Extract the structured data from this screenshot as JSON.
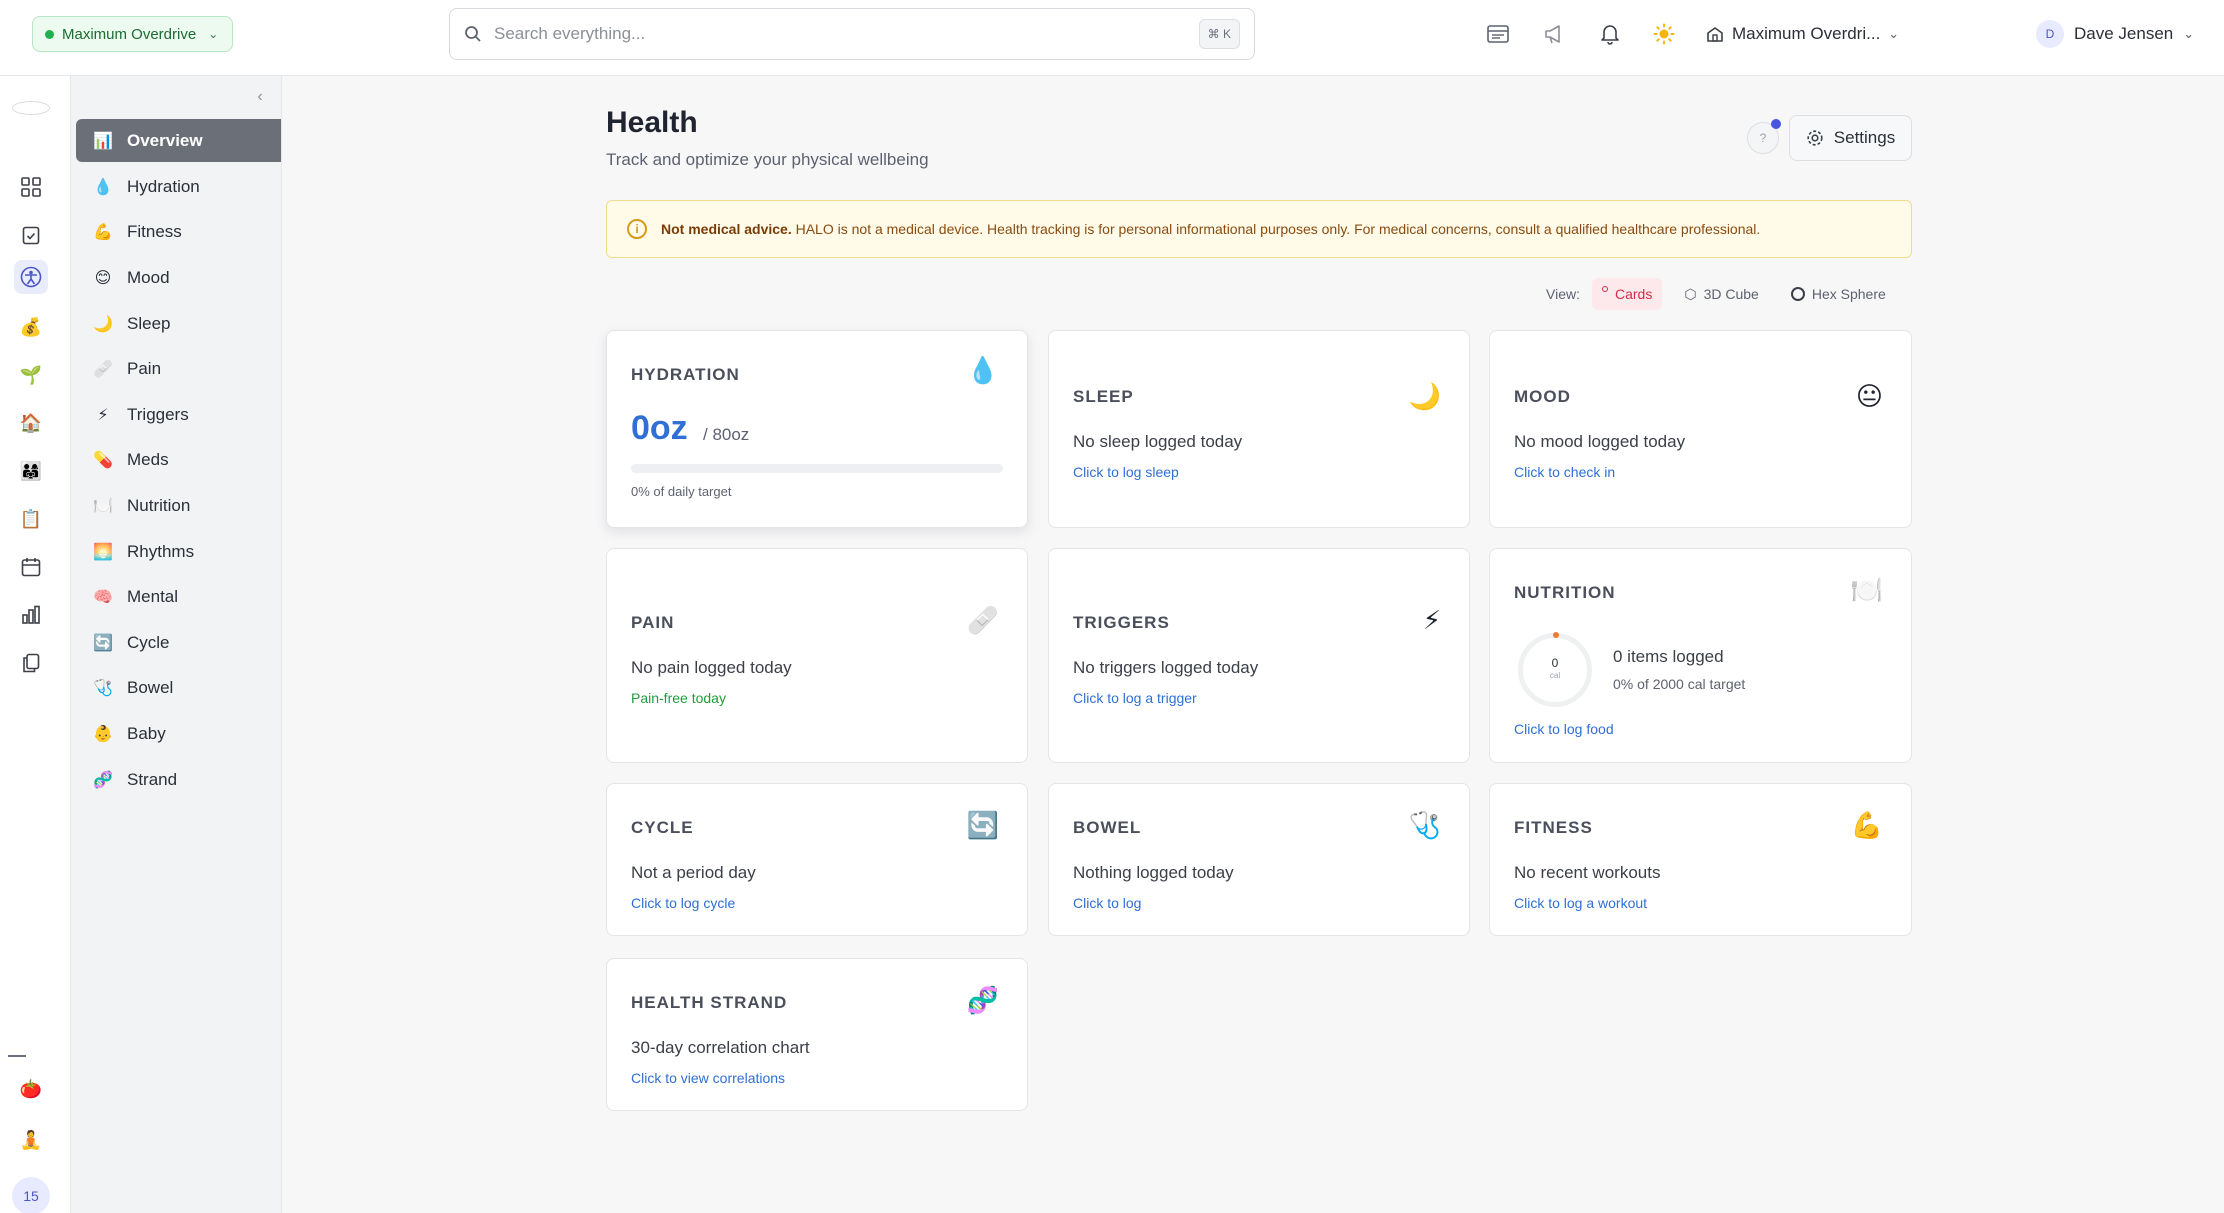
{
  "workspace": {
    "label": "Maximum Overdrive"
  },
  "search": {
    "placeholder": "Search everything...",
    "shortcut": "⌘ K"
  },
  "org": {
    "label": "Maximum Overdri..."
  },
  "user": {
    "initial": "D",
    "name": "Dave Jensen"
  },
  "rail": {
    "badge": "15"
  },
  "nav": [
    {
      "label": "Overview",
      "icon": "📊"
    },
    {
      "label": "Hydration",
      "icon": "💧"
    },
    {
      "label": "Fitness",
      "icon": "💪"
    },
    {
      "label": "Mood",
      "icon": "😊"
    },
    {
      "label": "Sleep",
      "icon": "🌙"
    },
    {
      "label": "Pain",
      "icon": "🩹"
    },
    {
      "label": "Triggers",
      "icon": "⚡"
    },
    {
      "label": "Meds",
      "icon": "💊"
    },
    {
      "label": "Nutrition",
      "icon": "🍽️"
    },
    {
      "label": "Rhythms",
      "icon": "🌅"
    },
    {
      "label": "Mental",
      "icon": "🧠"
    },
    {
      "label": "Cycle",
      "icon": "🔄"
    },
    {
      "label": "Bowel",
      "icon": "🩺"
    },
    {
      "label": "Baby",
      "icon": "👶"
    },
    {
      "label": "Strand",
      "icon": "🧬"
    }
  ],
  "page": {
    "title": "Health",
    "subtitle": "Track and optimize your physical wellbeing",
    "settings_label": "Settings"
  },
  "alert": {
    "strong": "Not medical advice.",
    "text": " HALO is not a medical device. Health tracking is for personal informational purposes only. For medical concerns, consult a qualified healthcare professional."
  },
  "view": {
    "label": "View:",
    "options": [
      "Cards",
      "3D Cube",
      "Hex Sphere"
    ],
    "selected": "Cards"
  },
  "cards": {
    "hydration": {
      "title": "HYDRATION",
      "icon": "💧",
      "value": "0oz",
      "target": "/ 80oz",
      "progress_pct": 0,
      "note": "0% of daily target"
    },
    "sleep": {
      "title": "SLEEP",
      "icon": "🌙",
      "text": "No sleep logged today",
      "link": "Click to log sleep"
    },
    "mood": {
      "title": "MOOD",
      "icon": "😐",
      "text": "No mood logged today",
      "link": "Click to check in"
    },
    "pain": {
      "title": "PAIN",
      "icon": "🩹",
      "text": "No pain logged today",
      "link": "Pain-free today"
    },
    "triggers": {
      "title": "TRIGGERS",
      "icon": "⚡",
      "text": "No triggers logged today",
      "link": "Click to log a trigger"
    },
    "nutrition": {
      "title": "NUTRITION",
      "icon": "🍽️",
      "gauge_value": "0",
      "gauge_unit": "cal",
      "items": "0 items logged",
      "target": "0% of 2000 cal target",
      "link": "Click to log food"
    },
    "cycle": {
      "title": "CYCLE",
      "icon": "🔄",
      "text": "Not a period day",
      "link": "Click to log cycle"
    },
    "bowel": {
      "title": "BOWEL",
      "icon": "🩺",
      "text": "Nothing logged today",
      "link": "Click to log"
    },
    "fitness": {
      "title": "FITNESS",
      "icon": "💪",
      "text": "No recent workouts",
      "link": "Click to log a workout"
    },
    "strand": {
      "title": "HEALTH STRAND",
      "icon": "🧬",
      "text": "30-day correlation chart",
      "link": "Click to view correlations"
    }
  },
  "colors": {
    "accent": "#2f6fd6",
    "active_nav": "#6b6f78",
    "alert_bg": "#fffbe8",
    "success": "#1f9d3e"
  }
}
